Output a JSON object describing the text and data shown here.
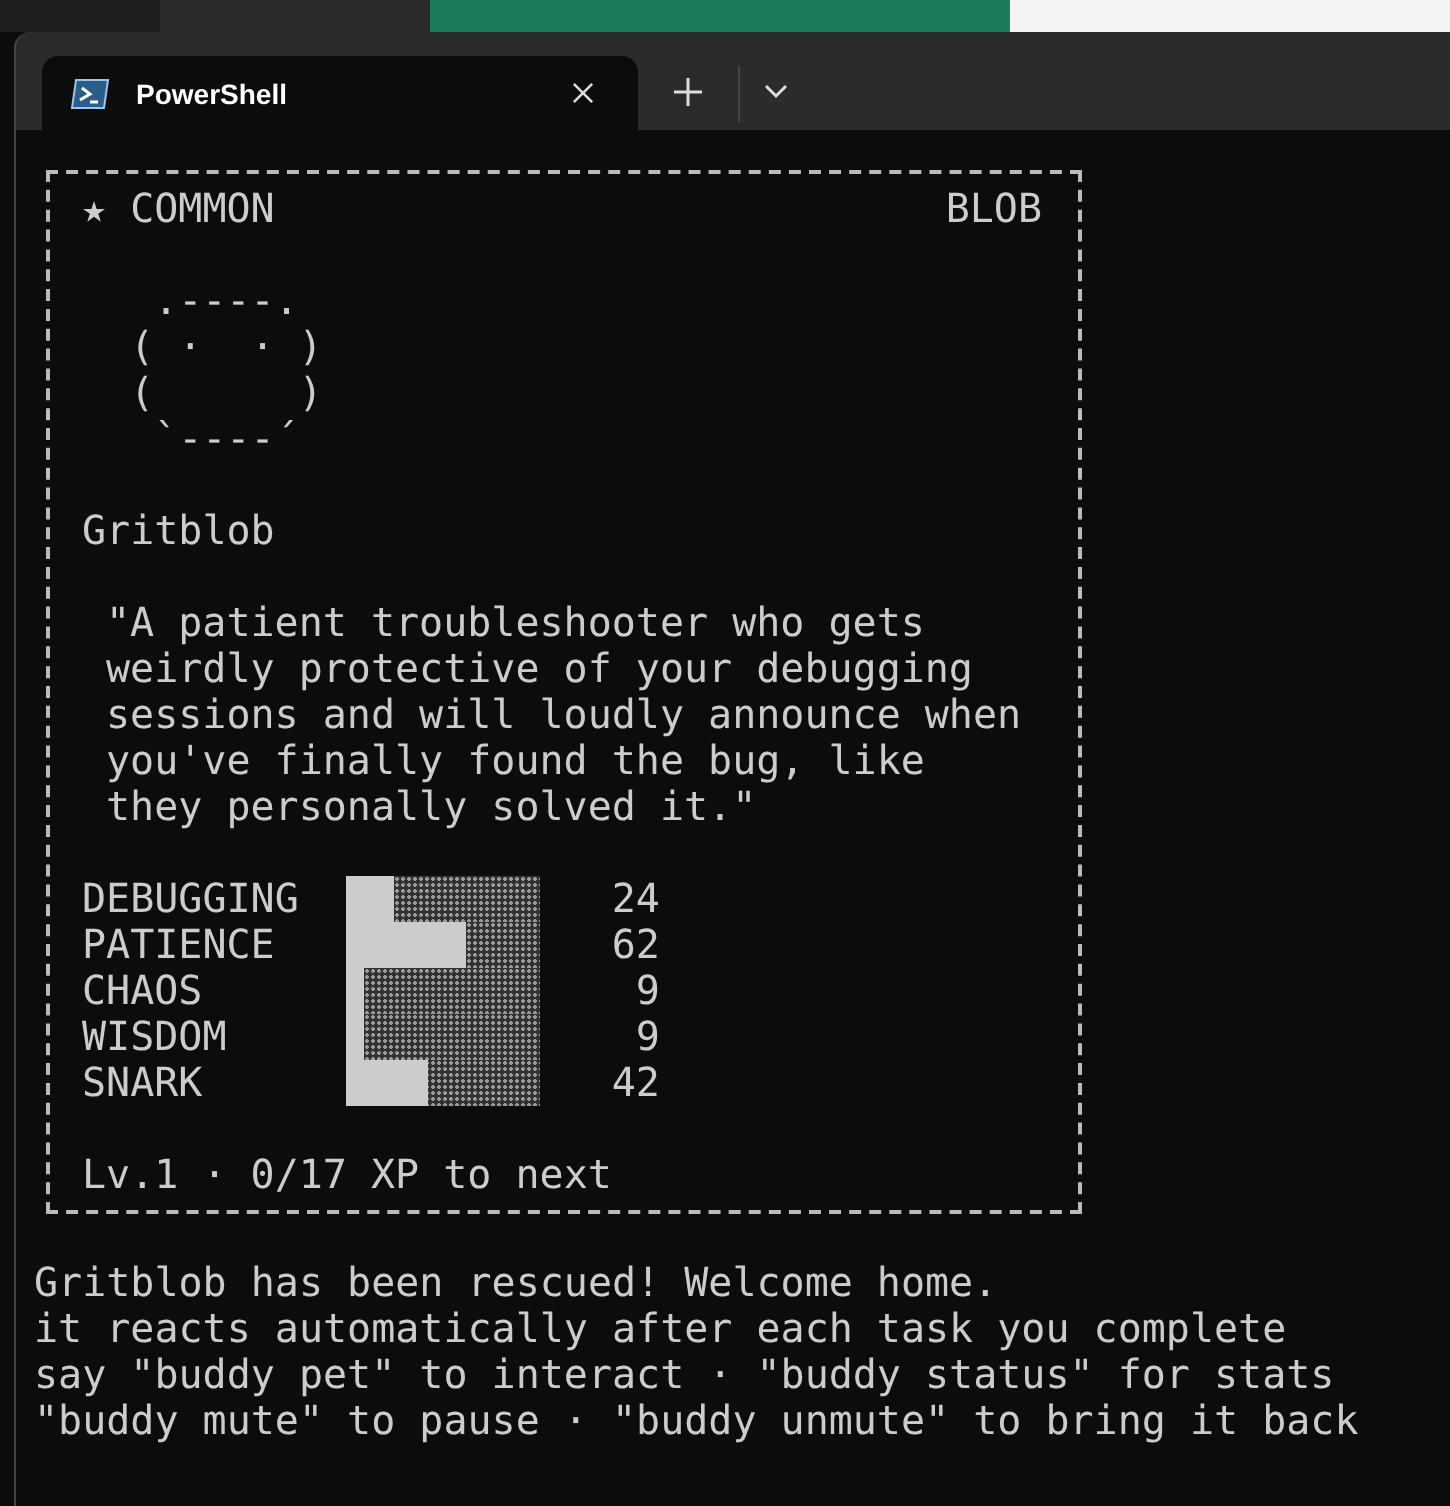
{
  "tabs": [
    {
      "title": "PowerShell",
      "selected": true
    }
  ],
  "card": {
    "rarity": "★ COMMON",
    "species": "BLOB",
    "art": [
      " .----.",
      "( ·  · )",
      "(      )",
      " `----´"
    ],
    "name": "Gritblob",
    "quote": "\"A patient troubleshooter who gets weirdly protective of your debugging sessions and will loudly announce when you've finally found the bug, like they personally solved it.\"",
    "stats": [
      {
        "name": "DEBUGGING",
        "level": 0.24,
        "value": "24"
      },
      {
        "name": "PATIENCE",
        "level": 0.62,
        "value": "62"
      },
      {
        "name": "CHAOS",
        "level": 0.09,
        "value": "9"
      },
      {
        "name": "WISDOM",
        "level": 0.09,
        "value": "9"
      },
      {
        "name": "SNARK",
        "level": 0.42,
        "value": "42"
      }
    ],
    "level": "Lv.1 · 0/17 XP to next"
  },
  "output": [
    "Gritblob has been rescued! Welcome home.",
    "it reacts automatically after each task you complete",
    "say \"buddy pet\" to interact · \"buddy status\" for stats",
    "\"buddy mute\" to pause · \"buddy unmute\" to bring it back"
  ]
}
